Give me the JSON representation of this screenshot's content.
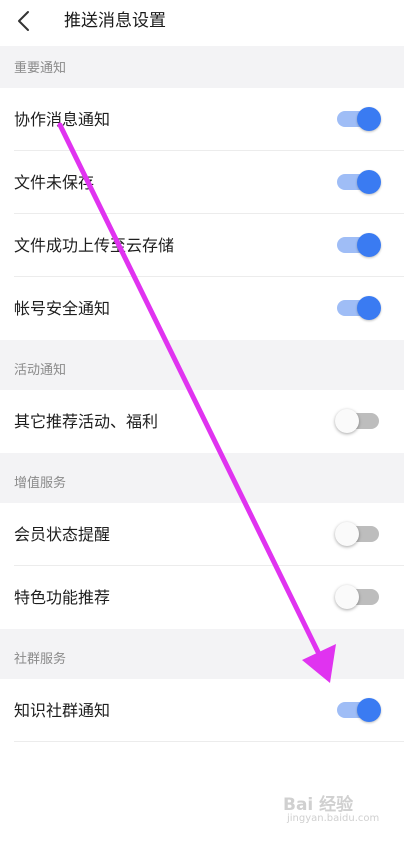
{
  "header": {
    "title": "推送消息设置",
    "back_icon": "chevron-left-icon"
  },
  "sections": [
    {
      "title": "重要通知",
      "items": [
        {
          "label": "协作消息通知",
          "enabled": true
        },
        {
          "label": "文件未保存",
          "enabled": true
        },
        {
          "label": "文件成功上传至云存储",
          "enabled": true
        },
        {
          "label": "帐号安全通知",
          "enabled": true
        }
      ]
    },
    {
      "title": "活动通知",
      "items": [
        {
          "label": "其它推荐活动、福利",
          "enabled": false
        }
      ]
    },
    {
      "title": "增值服务",
      "items": [
        {
          "label": "会员状态提醒",
          "enabled": false
        },
        {
          "label": "特色功能推荐",
          "enabled": false
        }
      ]
    },
    {
      "title": "社群服务",
      "items": [
        {
          "label": "知识社群通知",
          "enabled": true
        }
      ]
    }
  ],
  "colors": {
    "toggle_on_knob": "#3a7bf2",
    "toggle_on_track": "#9fbdf6",
    "toggle_off_track": "#bdbdbd",
    "section_bg": "#f3f3f5",
    "annotation_arrow": "#e033f0"
  },
  "watermark": {
    "main": "Bai 经验",
    "sub": "jingyan.baidu.com"
  }
}
